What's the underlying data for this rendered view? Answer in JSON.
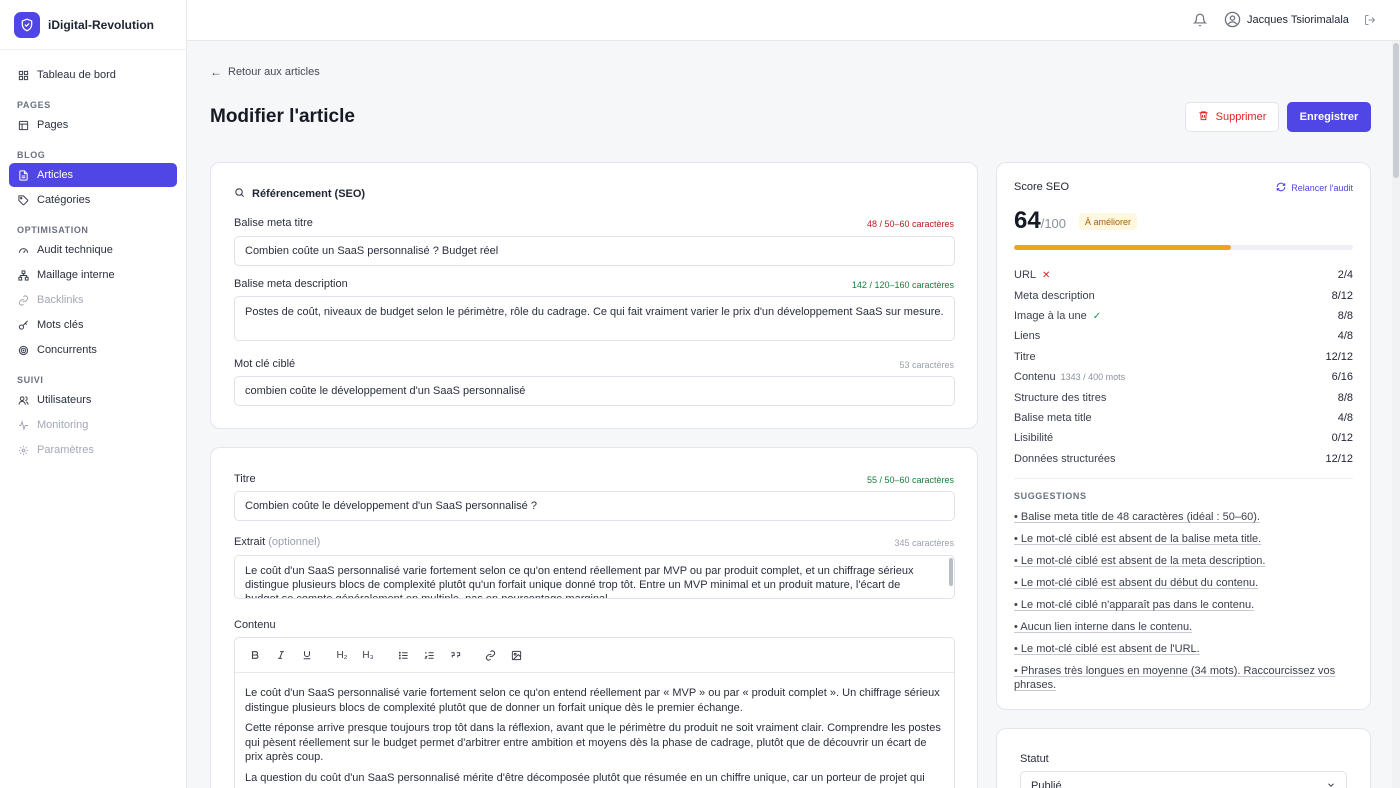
{
  "brand": {
    "name": "iDigital-Revolution"
  },
  "sidebar": {
    "dashboard": "Tableau de bord",
    "sections": {
      "pages": "PAGES",
      "blog": "BLOG",
      "optimisation": "OPTIMISATION",
      "suivi": "SUIVI"
    },
    "items": {
      "pages": "Pages",
      "articles": "Articles",
      "categories": "Catégories",
      "audit": "Audit technique",
      "maillage": "Maillage interne",
      "backlinks": "Backlinks",
      "mots_cles": "Mots clés",
      "concurrents": "Concurrents",
      "utilisateurs": "Utilisateurs",
      "monitoring": "Monitoring",
      "parametres": "Paramètres"
    }
  },
  "topbar": {
    "user_name": "Jacques Tsiorimalala"
  },
  "header": {
    "back_label": "Retour aux articles",
    "title": "Modifier l'article",
    "delete_label": "Supprimer",
    "save_label": "Enregistrer"
  },
  "seo": {
    "heading": "Référencement (SEO)",
    "meta_title": {
      "label": "Balise meta titre",
      "counter": "48 / 50–60 caractères",
      "value": "Combien coûte un SaaS personnalisé ? Budget réel"
    },
    "meta_description": {
      "label": "Balise meta description",
      "counter": "142 / 120–160 caractères",
      "value": "Postes de coût, niveaux de budget selon le périmètre, rôle du cadrage. Ce qui fait vraiment varier le prix d'un développement SaaS sur mesure."
    },
    "keyword": {
      "label": "Mot clé ciblé",
      "counter": "53 caractères",
      "value": "combien coûte le développement d'un SaaS personnalisé"
    }
  },
  "content": {
    "title": {
      "label": "Titre",
      "counter": "55 / 50–60 caractères",
      "value": "Combien coûte le développement d'un SaaS personnalisé ?"
    },
    "excerpt": {
      "label": "Extrait",
      "optional": "(optionnel)",
      "counter": "345 caractères",
      "value": "Le coût d'un SaaS personnalisé varie fortement selon ce qu'on entend réellement par MVP ou par produit complet, et un chiffrage sérieux distingue plusieurs blocs de complexité plutôt qu'un forfait unique donné trop tôt. Entre un MVP minimal et un produit mature, l'écart de budget se compte généralement en multiple, pas en pourcentage marginal."
    },
    "body_label": "Contenu",
    "toolbar": {
      "h2": "H₂",
      "h3": "H₃"
    },
    "paragraphs": [
      "Le coût d'un SaaS personnalisé varie fortement selon ce qu'on entend réellement par « MVP » ou par « produit complet ». Un chiffrage sérieux distingue plusieurs blocs de complexité plutôt que de donner un forfait unique dès le premier échange.",
      "Cette réponse arrive presque toujours trop tôt dans la réflexion, avant que le périmètre du produit ne soit vraiment clair. Comprendre les postes qui pèsent réellement sur le budget permet d'arbitrer entre ambition et moyens dès la phase de cadrage, plutôt que de découvrir un écart de prix après coup.",
      "La question du coût d'un SaaS personnalisé mérite d'être décomposée plutôt que résumée en un chiffre unique, car un porteur de projet qui"
    ]
  },
  "score": {
    "title": "Score SEO",
    "rerun": "Relancer l'audit",
    "value": "64",
    "max": "/100",
    "percent": 64,
    "badge": "À améliorer",
    "accent": "#f0a21a",
    "criteria": [
      {
        "label": "URL",
        "mark": "✕",
        "mark_type": "x",
        "note": "",
        "score": "2/4"
      },
      {
        "label": "Meta description",
        "mark": "",
        "mark_type": "",
        "note": "",
        "score": "8/12"
      },
      {
        "label": "Image à la une",
        "mark": "✓",
        "mark_type": "v",
        "note": "",
        "score": "8/8"
      },
      {
        "label": "Liens",
        "mark": "",
        "mark_type": "",
        "note": "",
        "score": "4/8"
      },
      {
        "label": "Titre",
        "mark": "",
        "mark_type": "",
        "note": "",
        "score": "12/12"
      },
      {
        "label": "Contenu",
        "mark": "",
        "mark_type": "",
        "note": "1343 / 400 mots",
        "score": "6/16"
      },
      {
        "label": "Structure des titres",
        "mark": "",
        "mark_type": "",
        "note": "",
        "score": "8/8"
      },
      {
        "label": "Balise meta title",
        "mark": "",
        "mark_type": "",
        "note": "",
        "score": "4/8"
      },
      {
        "label": "Lisibilité",
        "mark": "",
        "mark_type": "",
        "note": "",
        "score": "0/12"
      },
      {
        "label": "Données structurées",
        "mark": "",
        "mark_type": "",
        "note": "",
        "score": "12/12"
      }
    ],
    "suggestions_title": "SUGGESTIONS",
    "suggestions": [
      "• Balise meta title de 48 caractères (idéal : 50–60).",
      "• Le mot-clé ciblé est absent de la balise meta title.",
      "• Le mot-clé ciblé est absent de la meta description.",
      "• Le mot-clé ciblé est absent du début du contenu.",
      "• Le mot-clé ciblé n'apparaît pas dans le contenu.",
      "• Aucun lien interne dans le contenu.",
      "• Le mot-clé ciblé est absent de l'URL.",
      "• Phrases très longues en moyenne (34 mots). Raccourcissez vos phrases."
    ]
  },
  "status": {
    "label": "Statut",
    "value": "Publié"
  }
}
